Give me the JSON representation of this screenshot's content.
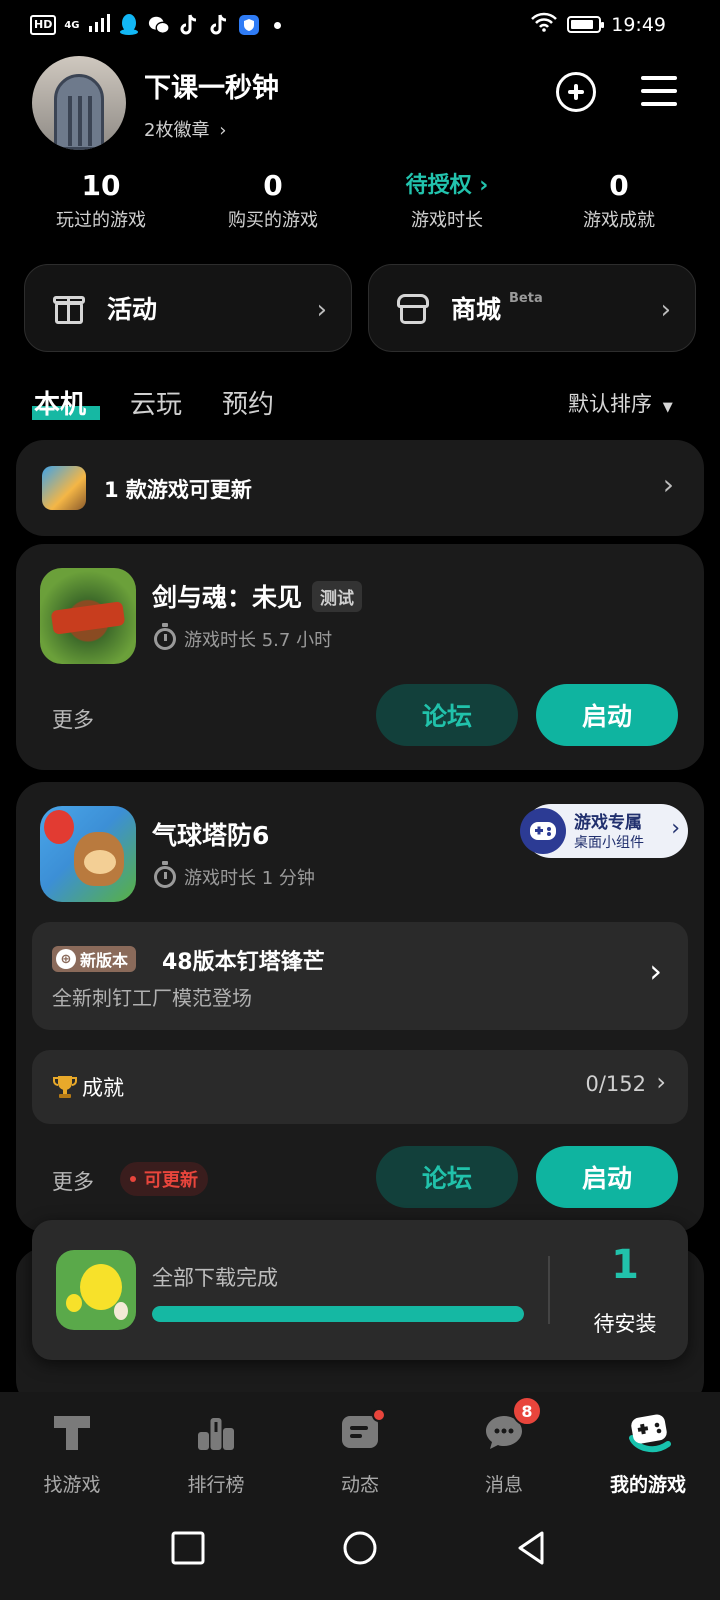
{
  "status_bar": {
    "network": "4G",
    "hd": "HD",
    "time": "19:49",
    "battery_level": 0.85
  },
  "profile": {
    "username": "下课一秒钟",
    "badges": "2枚徽章"
  },
  "stats": [
    {
      "value": "10",
      "label": "玩过的游戏"
    },
    {
      "value": "0",
      "label": "购买的游戏"
    },
    {
      "value": "待授权",
      "label": "游戏时长"
    },
    {
      "value": "0",
      "label": "游戏成就"
    }
  ],
  "quick": {
    "activity": "活动",
    "mall": "商城",
    "mall_tag": "Beta"
  },
  "tabs": [
    "本机",
    "云玩",
    "预约"
  ],
  "sort_label": "默认排序",
  "update_banner": "1 款游戏可更新",
  "game1": {
    "name": "剑与魂：未见",
    "tag": "测试",
    "playtime": "游戏时长 5.7 小时",
    "more": "更多",
    "forum": "论坛",
    "start": "启动"
  },
  "game2": {
    "name": "气球塔防6",
    "playtime": "游戏时长 1 分钟",
    "widget_title": "游戏专属",
    "widget_sub": "桌面小组件",
    "news_tag": "新版本",
    "news_title": "48版本钉塔锋芒",
    "news_sub": "全新刺钉工厂模范登场",
    "achievement_label": "成就",
    "achievement_value": "0/152",
    "more": "更多",
    "update_tag": "可更新",
    "forum": "论坛",
    "start": "启动"
  },
  "download_popup": {
    "status": "全部下载完成",
    "progress": 1.0,
    "count": "1",
    "count_label": "待安装"
  },
  "bottom_nav": [
    {
      "label": "找游戏",
      "icon": "discover-icon"
    },
    {
      "label": "排行榜",
      "icon": "ranking-icon"
    },
    {
      "label": "动态",
      "icon": "feed-icon"
    },
    {
      "label": "消息",
      "icon": "message-icon",
      "badge": "8"
    },
    {
      "label": "我的游戏",
      "icon": "gamepad-icon"
    }
  ],
  "colors": {
    "accent": "#0fb4a0",
    "accent_text": "#21c2ab",
    "card": "#1b1b1b",
    "badge_red": "#e8453c"
  }
}
